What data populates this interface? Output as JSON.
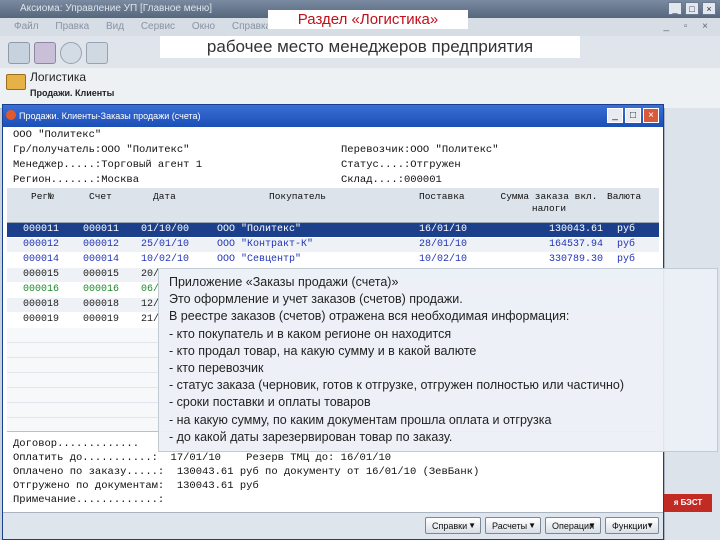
{
  "app": {
    "title": "Аксиома: Управление УП  [Главное меню]",
    "menu": [
      "Файл",
      "Правка",
      "Вид",
      "Сервис",
      "Окно",
      "Справка"
    ],
    "window_controls": [
      "_",
      "□",
      "×"
    ],
    "mdi_controls": "_ ▫ ×"
  },
  "slide": {
    "title": "Раздел «Логистика»",
    "subtitle": "рабочее  место менеджеров предприятия"
  },
  "nav": {
    "section": "Логистика",
    "subsection": "Продажи. Клиенты"
  },
  "dialog": {
    "title": "Продажи. Клиенты-Заказы продажи (счета)",
    "controls": [
      "_",
      "□",
      "×"
    ],
    "header_lines": [
      {
        "left": "ООО \"Политекс\"",
        "right": ""
      },
      {
        "left": "Гр/получатель:ООО \"Политекс\"",
        "right": "Перевозчик:ООО \"Политекс\""
      },
      {
        "left": "Менеджер.....:Торговый агент 1",
        "right": "Статус....:Отгружен"
      },
      {
        "left": "Регион.......:Москва",
        "right": "Склад....:000001"
      }
    ],
    "columns": {
      "num": "Рег№",
      "invoice": "Счет",
      "date": "Дата",
      "buyer": "Покупатель",
      "delivery": "Поставка",
      "amount": "Сумма заказа вкл. налоги",
      "currency": "Валюта"
    },
    "rows": [
      {
        "num": "000011",
        "invoice": "000011",
        "date": "01/10/00",
        "buyer": "ООО \"Политекс\"",
        "delivery": "16/01/10",
        "amount": "130043.61",
        "currency": "руб",
        "style": "sel"
      },
      {
        "num": "000012",
        "invoice": "000012",
        "date": "25/01/10",
        "buyer": "ООО \"Контракт-К\"",
        "delivery": "28/01/10",
        "amount": "164537.94",
        "currency": "руб",
        "style": "blue"
      },
      {
        "num": "000014",
        "invoice": "000014",
        "date": "10/02/10",
        "buyer": "ООО \"Севцентр\"",
        "delivery": "10/02/10",
        "amount": "330789.30",
        "currency": "руб",
        "style": "blue"
      },
      {
        "num": "000015",
        "invoice": "000015",
        "date": "20/",
        "buyer": "",
        "delivery": "",
        "amount": "",
        "currency": "",
        "style": "dark"
      },
      {
        "num": "000016",
        "invoice": "000016",
        "date": "06/",
        "buyer": "",
        "delivery": "",
        "amount": "",
        "currency": "",
        "style": "green"
      },
      {
        "num": "000018",
        "invoice": "000018",
        "date": "12/",
        "buyer": "",
        "delivery": "",
        "amount": "",
        "currency": "",
        "style": "dark"
      },
      {
        "num": "000019",
        "invoice": "000019",
        "date": "21/",
        "buyer": "",
        "delivery": "",
        "amount": "",
        "currency": "",
        "style": "dark"
      }
    ],
    "bottom_lines": [
      "Договор.............",
      "Оплатить до...........:  17/01/10    Резерв ТМЦ до: 16/01/10",
      "Оплачено по заказу.....:  130043.61 руб по документу от 16/01/10 (ЗевБанк)",
      "Отгружено по документам:  130043.61 руб",
      "Примечание.............:"
    ],
    "buttons": [
      {
        "label": "Справки"
      },
      {
        "label": "Расчеты"
      },
      {
        "label": "Операции"
      },
      {
        "label": "Функции"
      }
    ]
  },
  "side_badge": "я БЭСТ",
  "callout": {
    "lines": [
      "Приложение  «Заказы продажи (счета)»",
      "Это оформление и учет заказов (счетов) продажи.",
      "В реестре заказов (счетов)  отражена  вся  необходимая информация:",
      " -  кто покупатель и в каком регионе он находится",
      " - кто продал товар, на какую сумму и в какой валюте",
      " - кто перевозчик",
      " - статус заказа (черновик, готов  к отгрузке, отгружен полностью или  частично)",
      " - сроки поставки и оплаты товаров",
      " - на какую сумму, по каким документам прошла оплата и отгрузка",
      " - до какой даты зарезервирован товар по заказу."
    ]
  }
}
